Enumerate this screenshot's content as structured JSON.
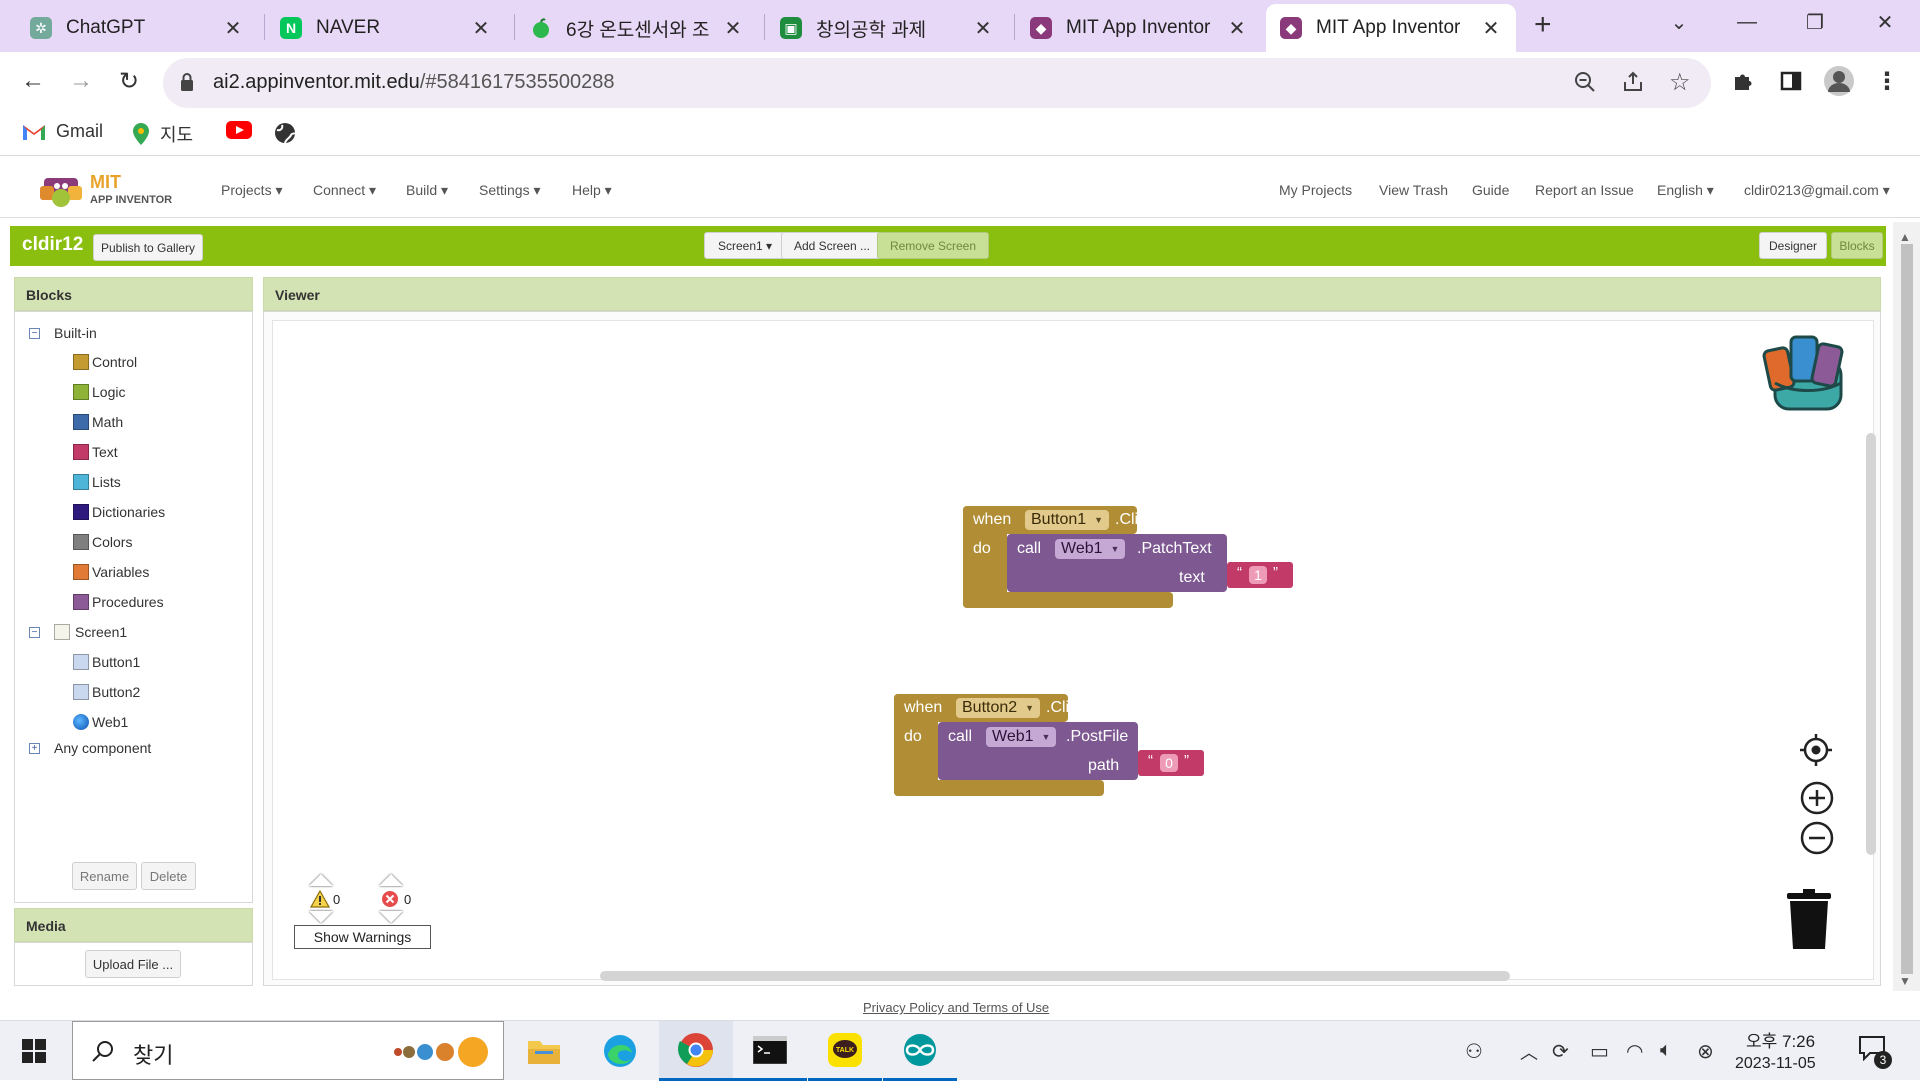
{
  "browser": {
    "tabs": [
      {
        "title": "ChatGPT",
        "icon": "chatgpt-icon",
        "color": "#74aa9c"
      },
      {
        "title": "NAVER",
        "icon": "naver-icon",
        "color": "#03c75a"
      },
      {
        "title": "6강 온도센서와 조",
        "icon": "apple-icon",
        "color": "#2db84d"
      },
      {
        "title": "창의공학 과제",
        "icon": "classroom-icon",
        "color": "#1e8e3e"
      },
      {
        "title": "MIT App Inventor",
        "icon": "appinventor-icon",
        "color": "#8a3a7a"
      },
      {
        "title": "MIT App Inventor",
        "icon": "appinventor-icon",
        "color": "#8a3a7a"
      }
    ],
    "active_tab": 5,
    "url_host": "ai2.appinventor.mit.edu",
    "url_path": "/#5841617535500288",
    "bookmarks": [
      {
        "label": "Gmail",
        "icon": "gmail-icon"
      },
      {
        "label": "지도",
        "icon": "maps-pin-icon"
      },
      {
        "label": "",
        "icon": "youtube-icon"
      },
      {
        "label": "",
        "icon": "globe-icon"
      }
    ]
  },
  "app": {
    "logo_top": "MIT",
    "logo_bottom": "APP INVENTOR",
    "menus": [
      "Projects ▾",
      "Connect ▾",
      "Build ▾",
      "Settings ▾",
      "Help ▾"
    ],
    "right_links": [
      "My Projects",
      "View Trash",
      "Guide",
      "Report an Issue",
      "English ▾",
      "cldir0213@gmail.com ▾"
    ],
    "project_name": "cldir12",
    "publish_label": "Publish to Gallery",
    "screen_select": "Screen1 ▾",
    "add_screen": "Add Screen ...",
    "remove_screen": "Remove Screen",
    "designer": "Designer",
    "blocks": "Blocks",
    "accent": "#8bbf0f"
  },
  "palette": {
    "title": "Blocks",
    "builtin_label": "Built-in",
    "builtin": [
      {
        "label": "Control",
        "color": "#c49a32"
      },
      {
        "label": "Logic",
        "color": "#8fb338"
      },
      {
        "label": "Math",
        "color": "#3d6aa8"
      },
      {
        "label": "Text",
        "color": "#c23a68"
      },
      {
        "label": "Lists",
        "color": "#4eb4d8"
      },
      {
        "label": "Dictionaries",
        "color": "#2d1a7c"
      },
      {
        "label": "Colors",
        "color": "#7f7f7f"
      },
      {
        "label": "Variables",
        "color": "#e07a35"
      },
      {
        "label": "Procedures",
        "color": "#8c5a96"
      }
    ],
    "screen_label": "Screen1",
    "components": [
      {
        "label": "Button1",
        "icon": "button-component-icon"
      },
      {
        "label": "Button2",
        "icon": "button-component-icon"
      },
      {
        "label": "Web1",
        "icon": "web-globe-icon"
      }
    ],
    "any_component": "Any component",
    "rename": "Rename",
    "delete": "Delete",
    "media_title": "Media",
    "upload": "Upload File ..."
  },
  "viewer": {
    "title": "Viewer",
    "block1": {
      "when": "when",
      "component": "Button1",
      "event": ".Click",
      "do": "do",
      "call": "call",
      "target": "Web1",
      "method": ".PatchText",
      "param": "text",
      "value": "1"
    },
    "block2": {
      "when": "when",
      "component": "Button2",
      "event": ".Click",
      "do": "do",
      "call": "call",
      "target": "Web1",
      "method": ".PostFile",
      "param": "path",
      "value": "0"
    },
    "warnings_count": "0",
    "errors_count": "0",
    "show_warnings": "Show Warnings",
    "colors": {
      "event": "#b18e35",
      "call": "#7d5891",
      "text": "#c23a68"
    }
  },
  "footer": {
    "privacy": "Privacy Policy and Terms of Use"
  },
  "taskbar": {
    "search_text": "찾기",
    "clock_time": "오후 7:26",
    "clock_date": "2023-11-05",
    "notification_count": "3"
  }
}
